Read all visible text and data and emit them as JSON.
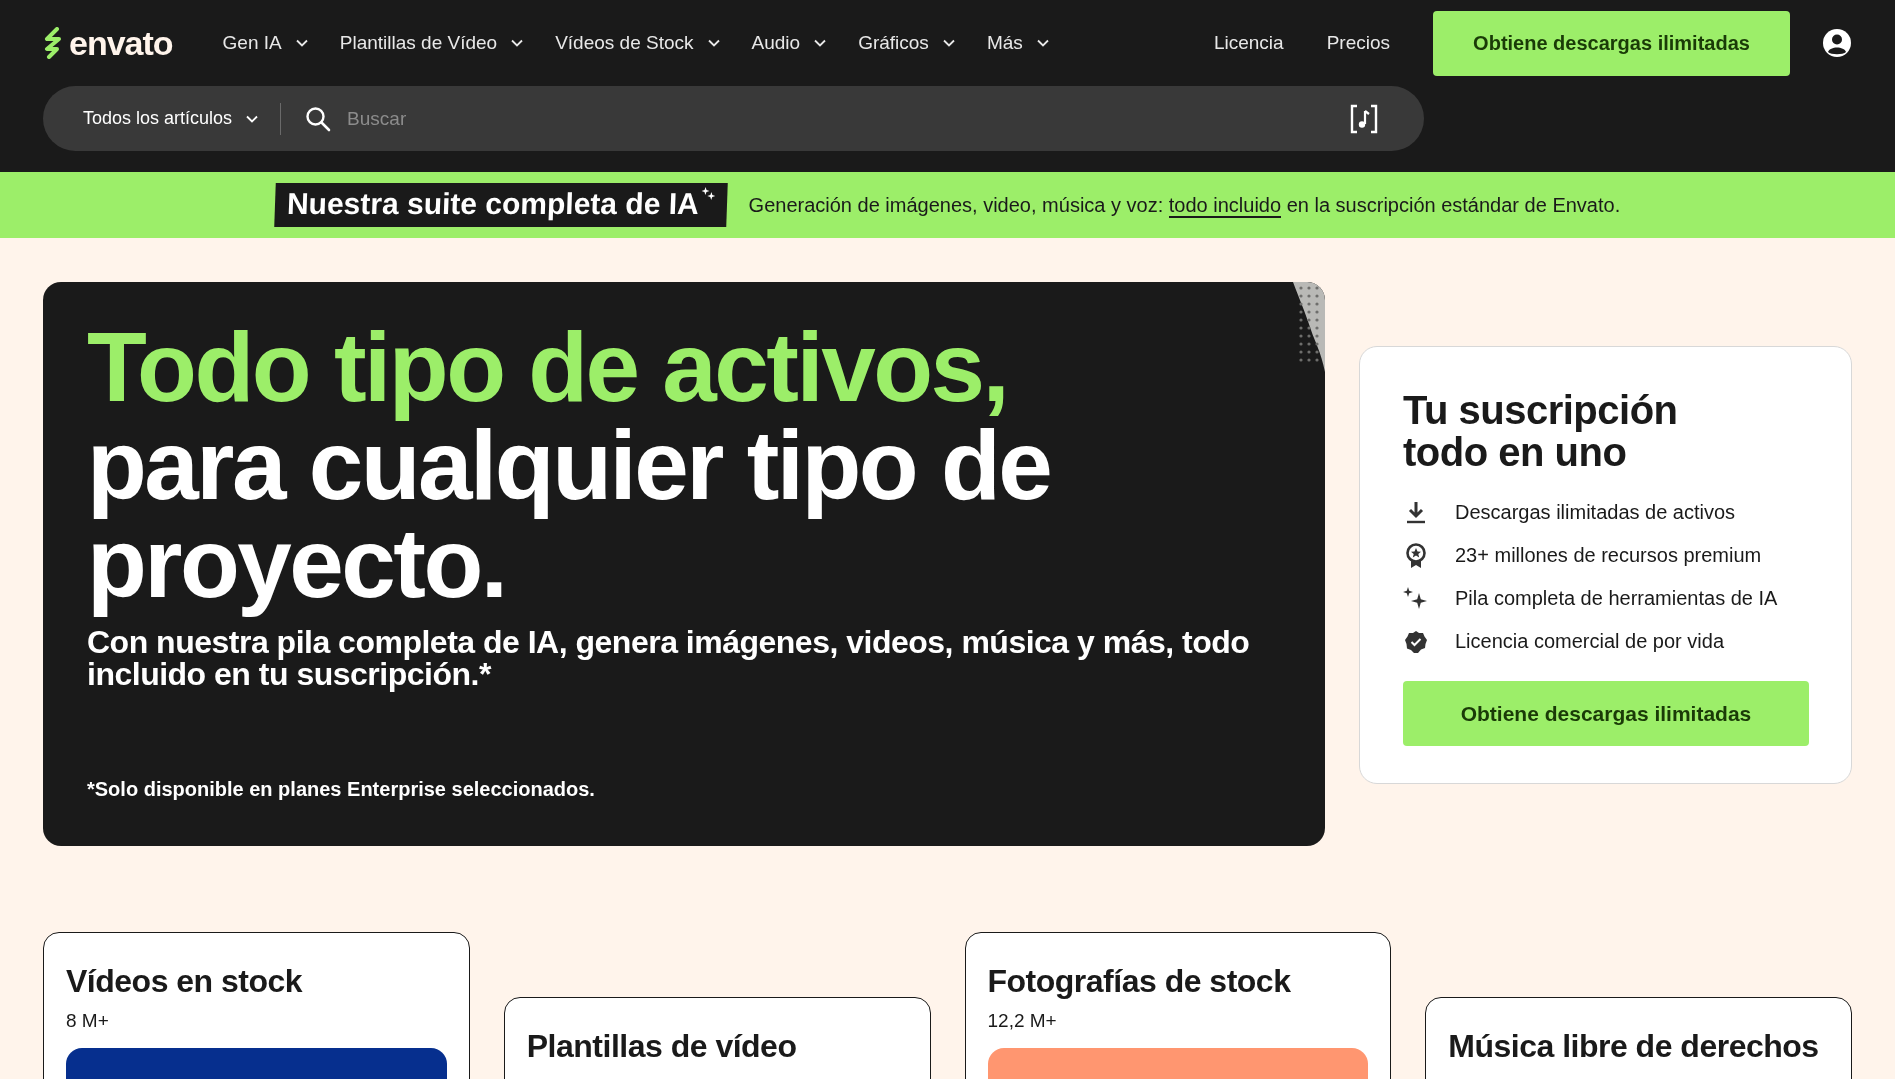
{
  "header": {
    "logo": "envato",
    "nav": [
      {
        "label": "Gen IA",
        "dropdown": true
      },
      {
        "label": "Plantillas de Vídeo",
        "dropdown": true
      },
      {
        "label": "Vídeos de Stock",
        "dropdown": true
      },
      {
        "label": "Audio",
        "dropdown": true
      },
      {
        "label": "Gráficos",
        "dropdown": true
      },
      {
        "label": "Más",
        "dropdown": true
      }
    ],
    "links": [
      "Licencia",
      "Precios"
    ],
    "cta": "Obtiene descargas ilimitadas",
    "search": {
      "category": "Todos los artículos",
      "placeholder": "Buscar"
    }
  },
  "banner": {
    "badge": "Nuestra suite completa de IA",
    "text_before": "Generación de imágenes, video, música y voz:",
    "link": "todo incluido",
    "text_after": "en la suscripción estándar de Envato."
  },
  "hero": {
    "title_highlight": "Todo tipo de activos,",
    "title_rest": "para cualquier tipo de proyecto.",
    "subtitle": "Con nuestra pila completa de IA, genera imágenes, videos, música y más, todo incluido en tu suscripción.*",
    "footnote": "*Solo disponible en planes Enterprise seleccionados."
  },
  "subscription_card": {
    "title": "Tu suscripción todo en uno",
    "features": [
      {
        "kind": "download",
        "text": "Descargas ilimitadas de activos"
      },
      {
        "kind": "award",
        "text": "23+ millones de recursos premium"
      },
      {
        "kind": "sparkles",
        "text": "Pila completa de herramientas de IA"
      },
      {
        "kind": "verified",
        "text": "Licencia comercial de por vida"
      }
    ],
    "button": "Obtiene descargas ilimitadas"
  },
  "categories": [
    {
      "title": "Vídeos en stock",
      "count": "8 M+"
    },
    {
      "title": "Plantillas de vídeo"
    },
    {
      "title": "Fotografías de stock",
      "count": "12,2 M+"
    },
    {
      "title": "Música libre de derechos"
    }
  ]
}
